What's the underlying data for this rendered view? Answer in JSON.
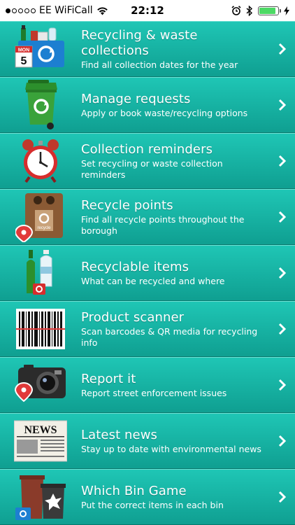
{
  "status_bar": {
    "carrier": "EE WiFiCall",
    "time": "22:12",
    "battery_level": 0.9
  },
  "menu": [
    {
      "icon": "recycling-collection-icon",
      "title": "Recycling & waste collections",
      "subtitle": "Find all collection dates for the year",
      "calendar_month": "MON",
      "calendar_day": "5"
    },
    {
      "icon": "wheelie-bin-icon",
      "title": "Manage requests",
      "subtitle": "Apply or book waste/recycling options"
    },
    {
      "icon": "alarm-clock-icon",
      "title": "Collection reminders",
      "subtitle": "Set recycling or waste collection reminders"
    },
    {
      "icon": "recycle-point-bin-icon",
      "title": "Recycle points",
      "subtitle": "Find all recycle points throughout the borough",
      "bin_label": "recycle"
    },
    {
      "icon": "bottles-icon",
      "title": "Recyclable items",
      "subtitle": "What can be recycled and where"
    },
    {
      "icon": "barcode-icon",
      "title": "Product scanner",
      "subtitle": "Scan barcodes & QR media for recycling info"
    },
    {
      "icon": "camera-icon",
      "title": "Report it",
      "subtitle": "Report street enforcement issues"
    },
    {
      "icon": "newspaper-icon",
      "title": "Latest news",
      "subtitle": "Stay up to date with environmental news",
      "news_label": "NEWS"
    },
    {
      "icon": "bins-game-icon",
      "title": "Which Bin Game",
      "subtitle": "Put the correct items in each bin"
    }
  ],
  "colors": {
    "row_top": "#1fc6b5",
    "row_bottom": "#0f9f91",
    "recycle_green": "#3aa23a",
    "recycle_blue": "#1d7fd1"
  }
}
